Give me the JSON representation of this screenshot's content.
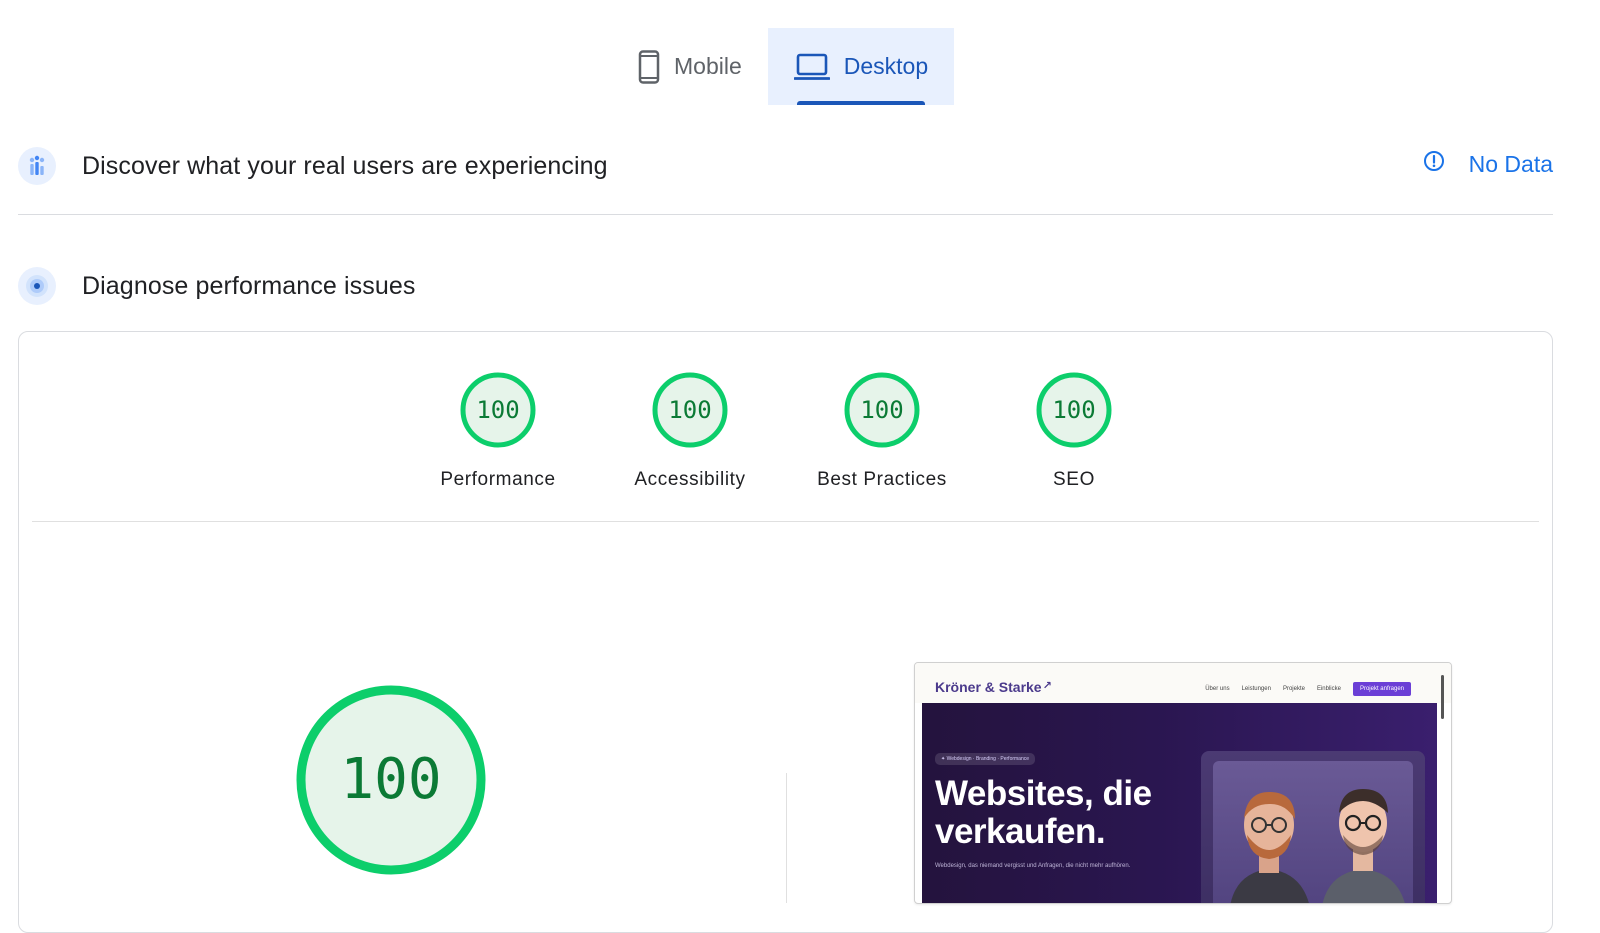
{
  "tabs": [
    {
      "label": "Mobile",
      "active": false,
      "icon": "phone-icon"
    },
    {
      "label": "Desktop",
      "active": true,
      "icon": "laptop-icon"
    }
  ],
  "field_data": {
    "title": "Discover what your real users are experiencing",
    "status": "No Data",
    "icon": "users-chart-icon",
    "status_icon": "info-icon"
  },
  "lab_data": {
    "title": "Diagnose performance issues",
    "icon": "radar-icon"
  },
  "categories": [
    {
      "label": "Performance",
      "score": "100"
    },
    {
      "label": "Accessibility",
      "score": "100"
    },
    {
      "label": "Best Practices",
      "score": "100"
    },
    {
      "label": "SEO",
      "score": "100"
    }
  ],
  "main_score": "100",
  "screenshot": {
    "brand": "Kröner & Starke",
    "brand_mark": "↗",
    "nav": [
      "Über uns",
      "Leistungen",
      "Projekte",
      "Einblicke"
    ],
    "cta": "Projekt anfragen",
    "chip": "✦ Webdesign · Branding · Performance",
    "headline_line1": "Websites, die",
    "headline_line2": "verkaufen.",
    "subline": "Webdesign, das niemand vergisst und Anfragen, die nicht mehr aufhören."
  },
  "colors": {
    "accent": "#1a56b8",
    "score_good": "#0cce6b",
    "score_text": "#0b7a35",
    "score_fill": "#e6f4ea"
  }
}
